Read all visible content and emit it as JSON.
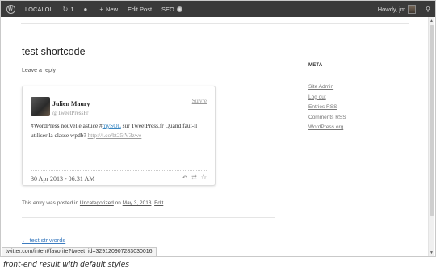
{
  "adminbar": {
    "site": "LOCALOL",
    "updates_count": "1",
    "new_label": "New",
    "edit_post_label": "Edit Post",
    "seo_label": "SEO",
    "howdy": "Howdy, jm"
  },
  "post": {
    "title": "test shortcode",
    "leave_reply": "Leave a reply"
  },
  "tweet": {
    "name": "Julien Maury",
    "handle": "@TweetPressFr",
    "follow_label": "Suivre",
    "text_before": "#WordPress nouvelle astuce #",
    "hashtag": "mySQL",
    "text_middle": " sur TweetPress.fr Quand faut-il utiliser la classe wpdb? ",
    "link": "http://t.co/bt25tV3zwe",
    "date": "30 Apr 2013 - 06:31 AM"
  },
  "entry_meta": {
    "prefix": "This entry was posted in ",
    "category": "Uncategorized",
    "on": " on ",
    "date": "May 3, 2013",
    "sep": ". ",
    "edit": "Edit"
  },
  "nav": {
    "prev_post": "← test str words"
  },
  "sidebar": {
    "meta_title": "META",
    "items": [
      {
        "label": "Site Admin"
      },
      {
        "label": "Log out"
      },
      {
        "label": "Entries RSS"
      },
      {
        "label": "Comments RSS"
      },
      {
        "label": "WordPress.org"
      }
    ]
  },
  "statusbar": {
    "url": "twitter.com/intent/favorite?tweet_id=329120907283030016"
  },
  "caption": "front-end result with default styles",
  "colors": {
    "adminbar_bg": "#3a3a3a",
    "link_blue": "#3b88c3"
  }
}
